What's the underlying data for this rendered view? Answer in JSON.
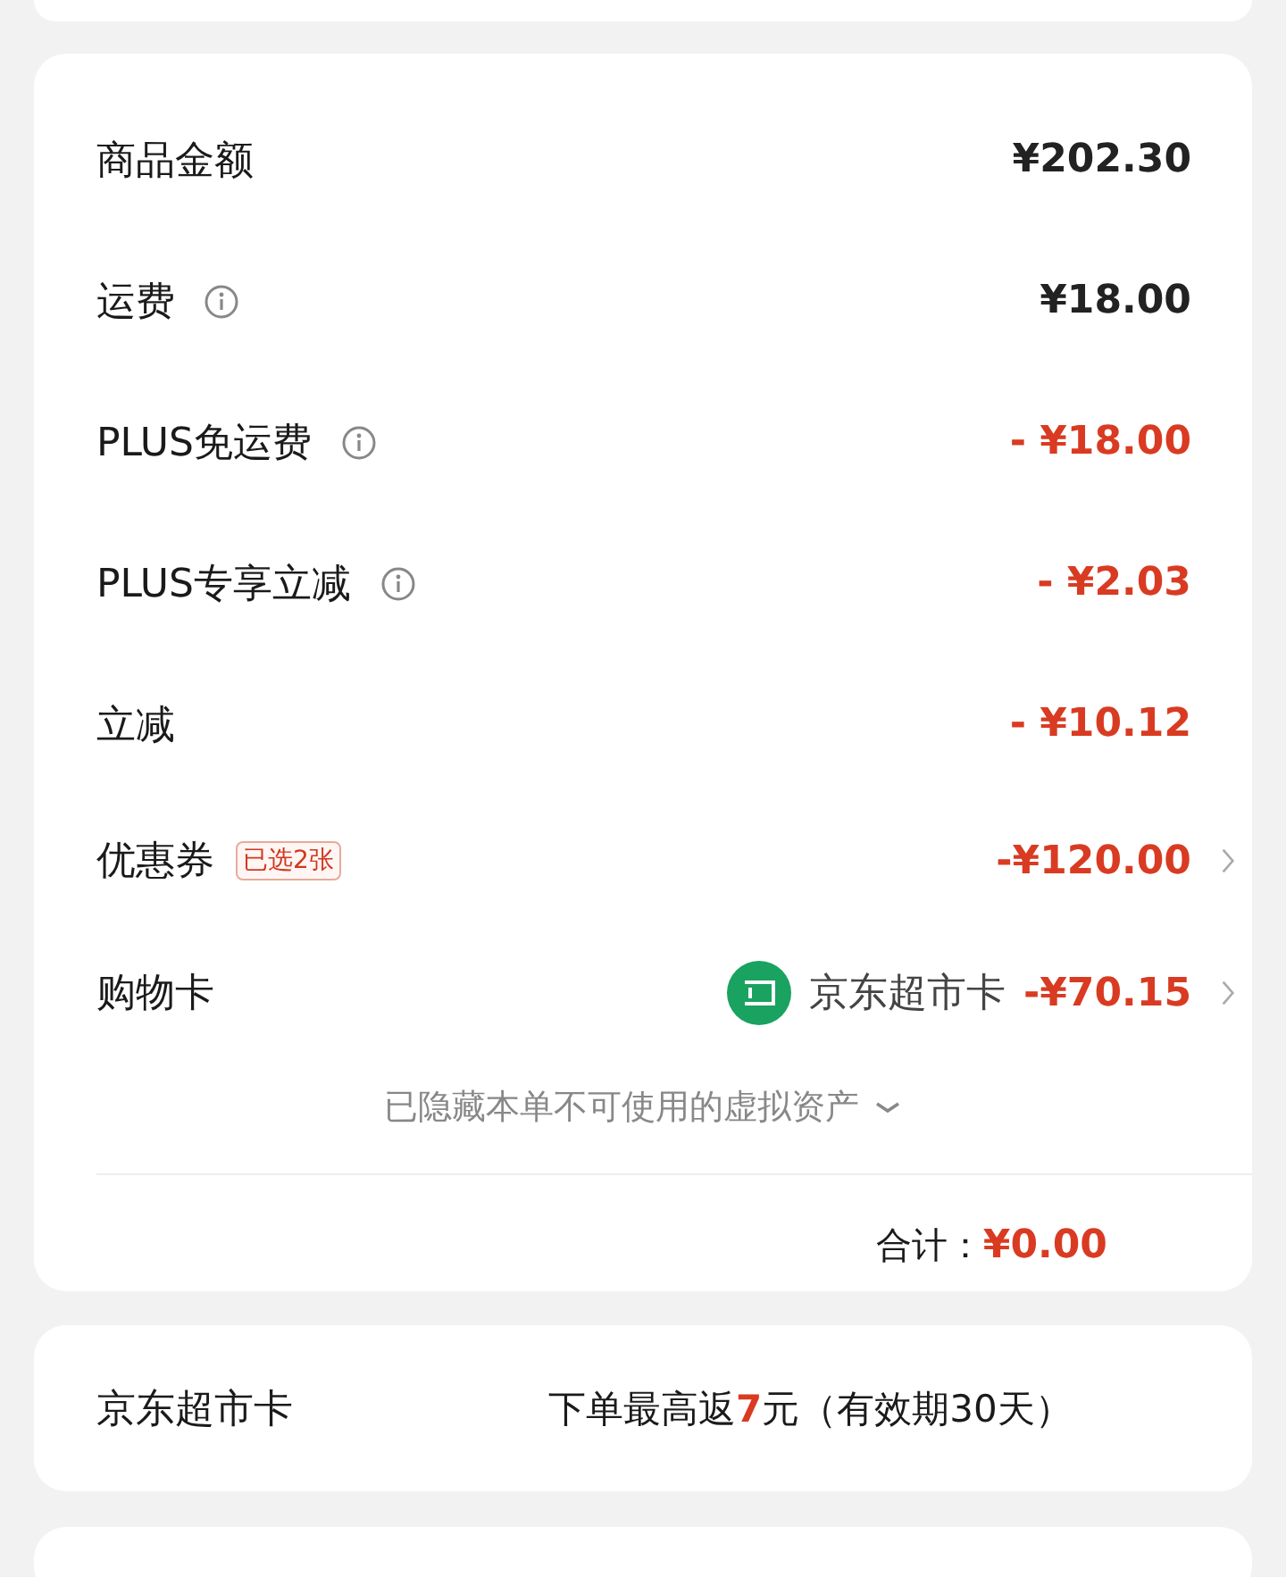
{
  "summary": {
    "rows": [
      {
        "label": "商品金额",
        "info": false,
        "kind": "charge",
        "value": "¥202.30",
        "chevron": false
      },
      {
        "label": "运费",
        "info": true,
        "kind": "charge",
        "value": "¥18.00",
        "chevron": false
      },
      {
        "label": "PLUS免运费",
        "info": true,
        "kind": "discount",
        "value": "- ¥18.00",
        "chevron": false
      },
      {
        "label": "PLUS专享立减",
        "info": true,
        "kind": "discount",
        "value": "- ¥2.03",
        "chevron": false
      },
      {
        "label": "立减",
        "info": false,
        "kind": "discount",
        "value": "- ¥10.12",
        "chevron": false
      },
      {
        "label": "优惠券",
        "info": false,
        "badge": "已选2张",
        "kind": "discount",
        "value": "-¥120.00",
        "chevron": true
      },
      {
        "label": "购物卡",
        "info": false,
        "card": "京东超市卡",
        "kind": "discount",
        "value": "-¥70.15",
        "chevron": true
      }
    ],
    "hidden_note": "已隐藏本单不可使用的虚拟资产",
    "total_label": "合计：",
    "total_value": "¥0.00"
  },
  "rebate": {
    "label": "京东超市卡",
    "text": "下单最高返**7**元（有效期30天）"
  }
}
